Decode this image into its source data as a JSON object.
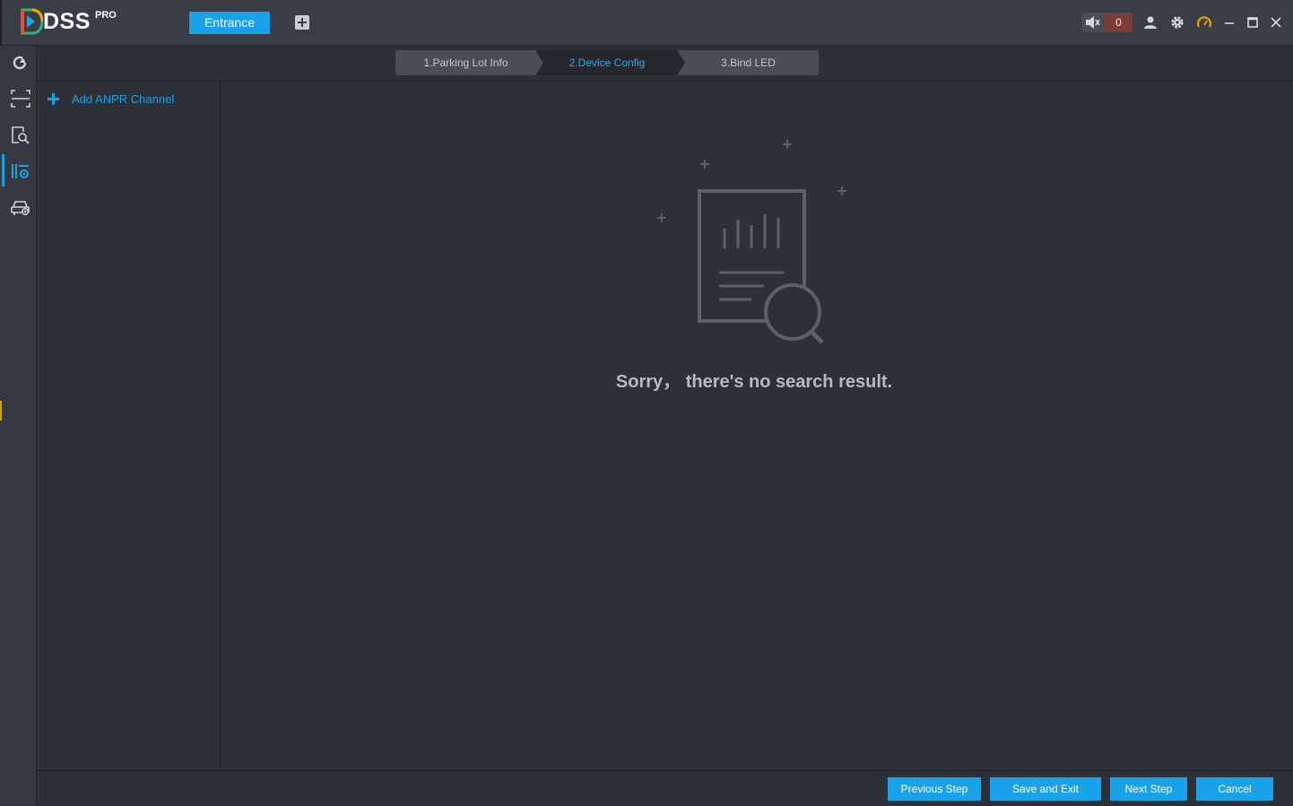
{
  "app": {
    "logo_text": "DSS",
    "logo_sup": "PRO"
  },
  "header": {
    "active_tab": "Entrance",
    "alarm_count": "0"
  },
  "steps": [
    {
      "label": "1.Parking Lot Info",
      "state": "done"
    },
    {
      "label": "2.Device Config",
      "state": "active"
    },
    {
      "label": "3.Bind LED",
      "state": "pending"
    }
  ],
  "left_panel": {
    "add_label": "Add ANPR Channel"
  },
  "main": {
    "empty_message": "Sorry，  there's no search result."
  },
  "footer": {
    "previous_label": "Previous Step",
    "save_exit_label": "Save and Exit",
    "next_label": "Next Step",
    "cancel_label": "Cancel"
  },
  "icons": {
    "rail": [
      "refresh-icon",
      "capture-frame-icon",
      "search-record-icon",
      "parking-config-icon",
      "vehicle-icon"
    ],
    "top": [
      "speaker-icon",
      "user-icon",
      "gear-icon",
      "gauge-icon",
      "minimize-icon",
      "maximize-icon",
      "close-icon"
    ]
  },
  "colors": {
    "accent": "#1aa2e8",
    "alarm": "#7d3d37",
    "gauge": "#e8a000"
  }
}
